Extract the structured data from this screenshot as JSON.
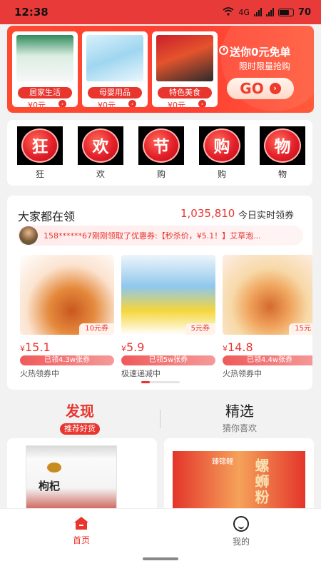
{
  "status_bar": {
    "time": "12:38",
    "network": "4G",
    "battery": "70"
  },
  "banner": {
    "cards": [
      {
        "tag": "居家生活",
        "price": "¥0元",
        "image": "home-goods-image"
      },
      {
        "tag": "母婴用品",
        "price": "¥0元",
        "image": "baby-goods-image"
      },
      {
        "tag": "特色美食",
        "price": "¥0元",
        "image": "food-goods-image"
      }
    ],
    "title": "送你0元免单",
    "subtitle": "限时限量抢购",
    "go_label": "GO"
  },
  "festival": {
    "items": [
      {
        "char": "狂",
        "label": "狂"
      },
      {
        "char": "欢",
        "label": "欢"
      },
      {
        "char": "节",
        "label": "购"
      },
      {
        "char": "购",
        "label": "购"
      },
      {
        "char": "物",
        "label": "物"
      }
    ]
  },
  "claims": {
    "title": "大家都在领",
    "count": "1,035,810",
    "count_label": "今日实时领券",
    "ticker": "158******67刚刚领取了优惠券:【秒杀价，¥5.1！】艾草泡...",
    "products": [
      {
        "coupon": "10元券",
        "price": "15.1",
        "bar": "已领4.3w张券",
        "status": "火热领券中"
      },
      {
        "coupon": "5元券",
        "price": "5.9",
        "bar": "已领5w张券",
        "status": "极速递减中"
      },
      {
        "coupon": "15元",
        "price": "14.8",
        "bar": "已领4.4w张券",
        "status": "火热领券中"
      }
    ]
  },
  "section_tabs": {
    "discover": {
      "title": "发现",
      "sub": "推荐好货"
    },
    "selected": {
      "title": "精选",
      "sub": "猜你喜欢"
    }
  },
  "feed": {
    "item1": {
      "title": "枸杞"
    },
    "item2": {
      "title": "螺蛳粉",
      "brand": "臻锦鲤"
    }
  },
  "bottom_nav": {
    "home": "首页",
    "mine": "我的"
  },
  "colors": {
    "accent": "#e8352e",
    "banner": "#ff4a2f"
  }
}
